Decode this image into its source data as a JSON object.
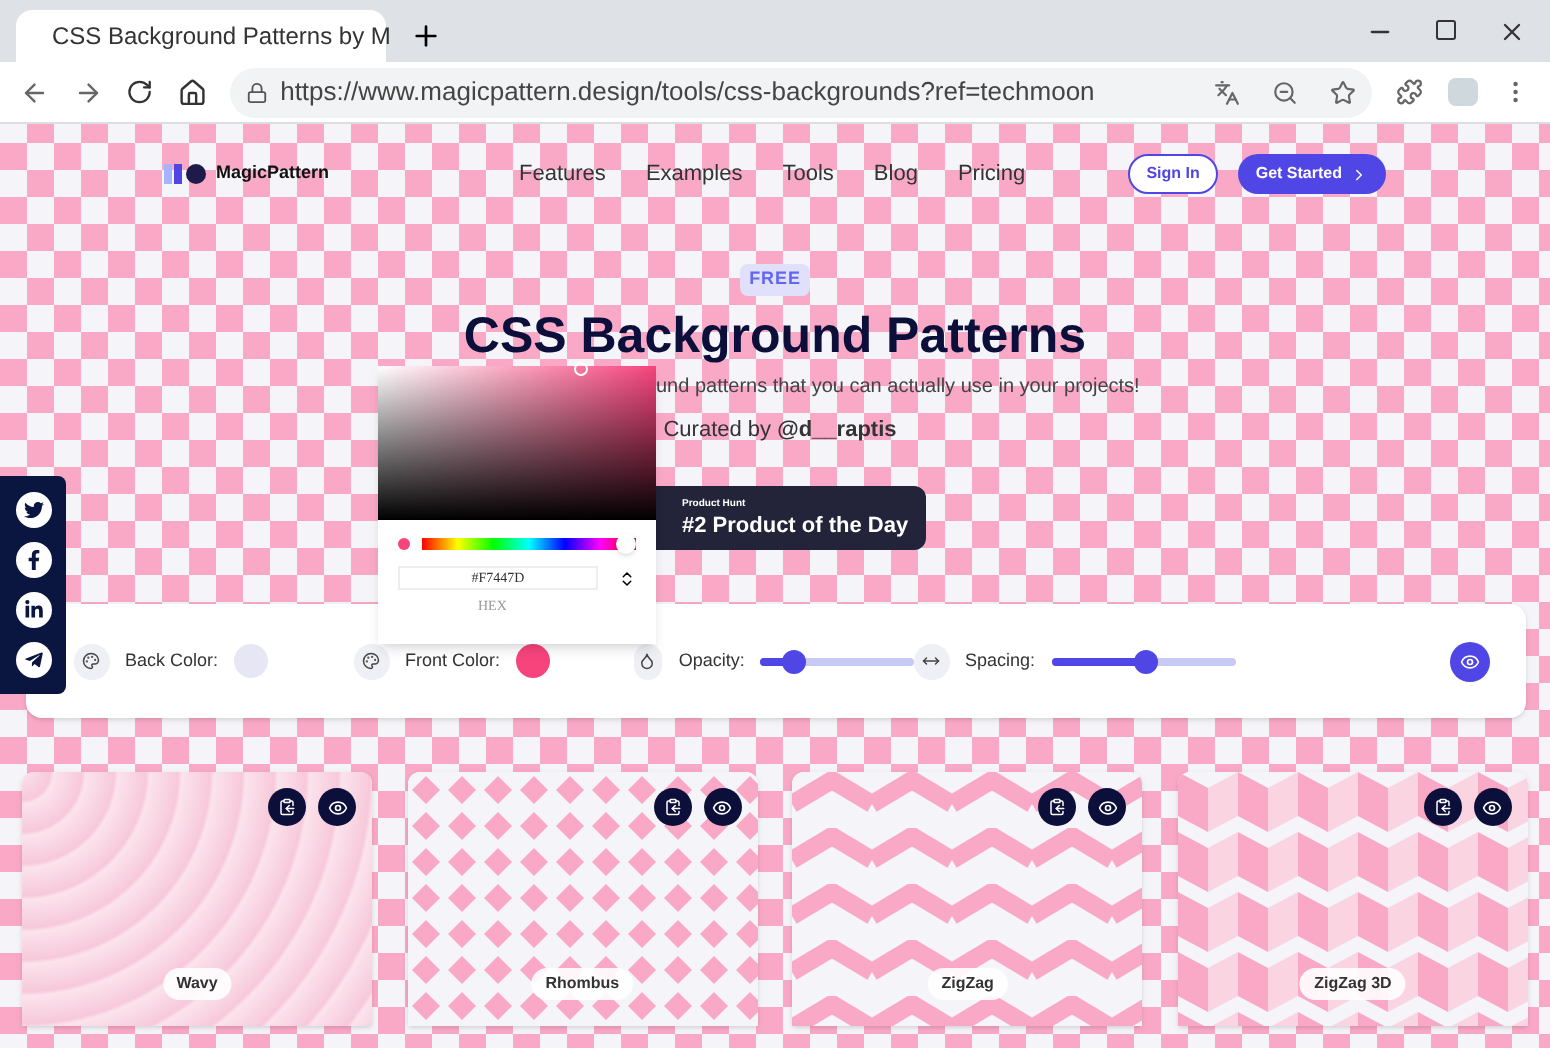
{
  "browser": {
    "tab_title": "CSS Background Patterns by M",
    "url": "https://www.magicpattern.design/tools/css-backgrounds?ref=techmoon"
  },
  "nav": {
    "logo": "MagicPattern",
    "links": [
      "Features",
      "Examples",
      "Tools",
      "Blog",
      "Pricing"
    ],
    "sign_in": "Sign In",
    "get_started": "Get Started"
  },
  "hero": {
    "badge": "FREE",
    "title": "CSS Background Patterns",
    "subtitle": "und patterns that you can actually use in your projects!",
    "curated": "Curated by **@d__raptis**"
  },
  "product_hunt": {
    "label": "Product Hunt",
    "text": "#2 Product of the Day"
  },
  "color_picker": {
    "hex": "#F7447D",
    "format": "HEX",
    "level": 0.95
  },
  "controls": [
    {
      "kind": "color",
      "label": "Back Color:",
      "color": "#e6e6f5"
    },
    {
      "kind": "color",
      "label": "Front Color:",
      "color": "#f7447d"
    },
    {
      "kind": "slider",
      "label": "Opacity:",
      "level": 0.22
    },
    {
      "kind": "slider",
      "label": "Spacing:",
      "level": 0.52
    }
  ],
  "cards": [
    {
      "kind": "wavy",
      "name": "Wavy"
    },
    {
      "kind": "rhombus",
      "name": "Rhombus"
    },
    {
      "kind": "zigzag",
      "name": "ZigZag"
    },
    {
      "kind": "zigzag3d",
      "name": "ZigZag 3D"
    }
  ]
}
